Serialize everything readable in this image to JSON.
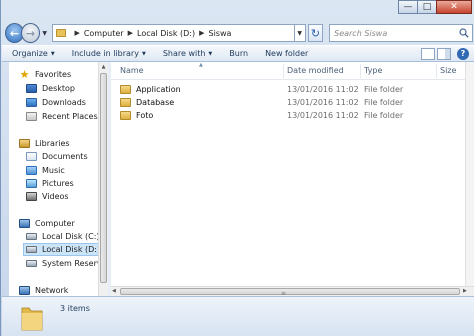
{
  "window": {
    "minimize_glyph": "—",
    "maximize_glyph": "□",
    "close_glyph": "✕"
  },
  "address": {
    "crumbs": [
      "Computer",
      "Local Disk (D:)",
      "Siswa"
    ],
    "search_placeholder": "Search Siswa"
  },
  "toolbar": {
    "organize": "Organize",
    "include_in_library": "Include in library",
    "share_with": "Share with",
    "burn": "Burn",
    "new_folder": "New folder"
  },
  "nav": {
    "favorites": "Favorites",
    "desktop": "Desktop",
    "downloads": "Downloads",
    "recent_places": "Recent Places",
    "libraries": "Libraries",
    "documents": "Documents",
    "music": "Music",
    "pictures": "Pictures",
    "videos": "Videos",
    "computer": "Computer",
    "local_disk_c": "Local Disk (C:)",
    "local_disk_d": "Local Disk (D:)",
    "system_reserved": "System Reserved",
    "network": "Network"
  },
  "columns": {
    "name": "Name",
    "date_modified": "Date modified",
    "type": "Type",
    "size": "Size"
  },
  "files": [
    {
      "name": "Application",
      "date": "13/01/2016 11:02",
      "type": "File folder"
    },
    {
      "name": "Database",
      "date": "13/01/2016 11:02",
      "type": "File folder"
    },
    {
      "name": "Foto",
      "date": "13/01/2016 11:02",
      "type": "File folder"
    }
  ],
  "details": {
    "item_count": "3 items"
  }
}
